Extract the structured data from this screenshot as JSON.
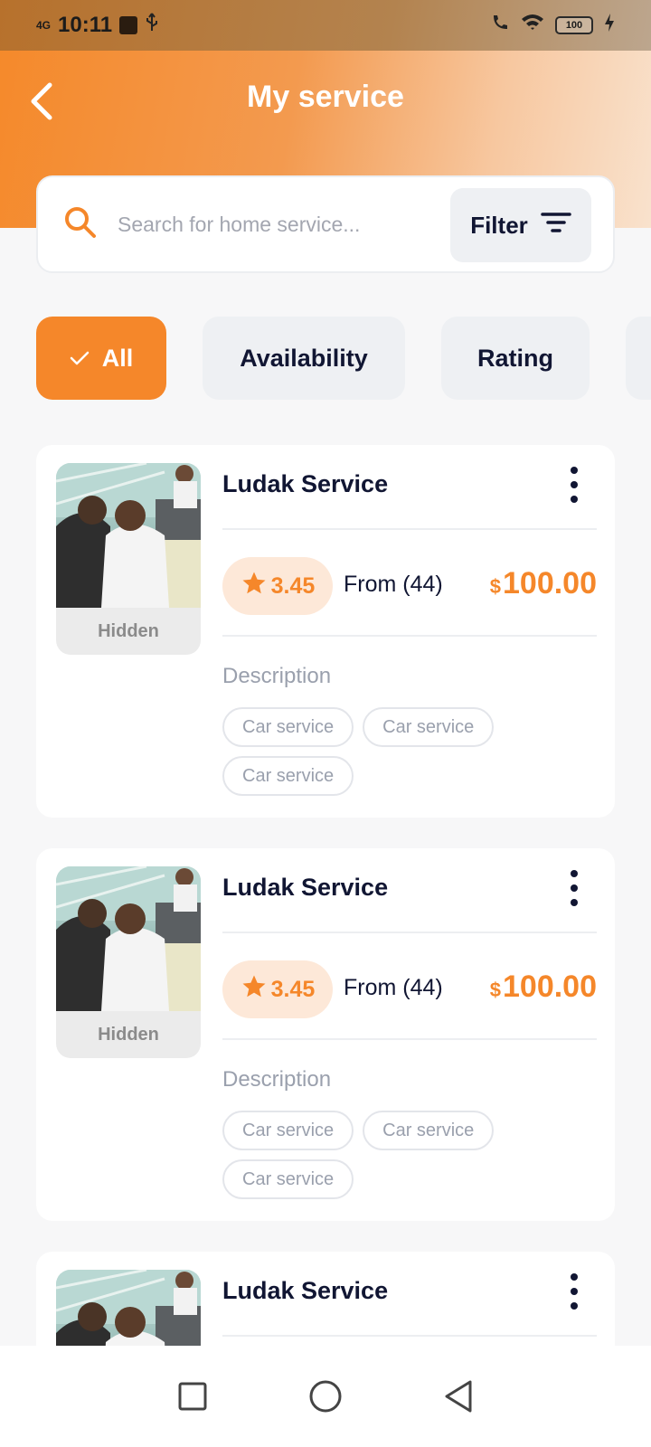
{
  "status_bar": {
    "network": "4G",
    "time": "10:11",
    "battery": "100"
  },
  "header": {
    "title": "My service"
  },
  "search": {
    "placeholder": "Search for home service...",
    "filter_label": "Filter"
  },
  "chips": [
    {
      "label": "All",
      "active": true
    },
    {
      "label": "Availability",
      "active": false
    },
    {
      "label": "Rating",
      "active": false
    }
  ],
  "services": [
    {
      "title": "Ludak Service",
      "status": "Hidden",
      "rating": "3.45",
      "reviews": "From (44)",
      "currency": "$",
      "price": "100.00",
      "description_label": "Description",
      "tags": [
        "Car service",
        "Car service",
        "Car service"
      ]
    },
    {
      "title": "Ludak Service",
      "status": "Hidden",
      "rating": "3.45",
      "reviews": "From (44)",
      "currency": "$",
      "price": "100.00",
      "description_label": "Description",
      "tags": [
        "Car service",
        "Car service",
        "Car service"
      ]
    },
    {
      "title": "Ludak Service"
    }
  ],
  "colors": {
    "accent": "#f5872a",
    "dark_text": "#111633",
    "chip_bg": "#eef0f3"
  }
}
